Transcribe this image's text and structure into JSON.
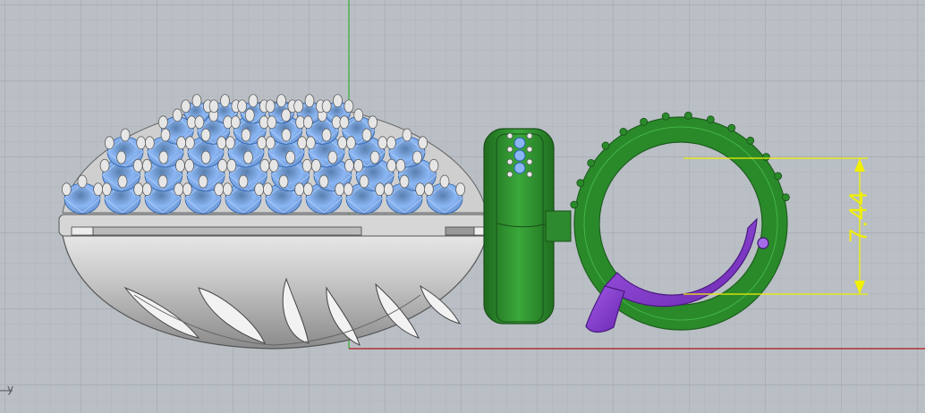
{
  "viewport": {
    "axis_label": "y",
    "colors": {
      "background": "#b9bfc5",
      "grid_minor": "#aeb4ba",
      "grid_major": "#a2a8ae",
      "axis_green": "#3fae3f",
      "axis_red": "#b01414",
      "dimension": "#f2f000"
    }
  },
  "dimension": {
    "label": "7.44"
  },
  "parts": {
    "pavé_body": {
      "color": "#c8c8c8"
    },
    "gemstones": {
      "color": "#8ab6f4"
    },
    "bail": {
      "color": "#2f8f2f"
    },
    "clasp_ring": {
      "color": "#2f8f2f"
    },
    "clasp_lever": {
      "color": "#8a3fd0"
    }
  }
}
